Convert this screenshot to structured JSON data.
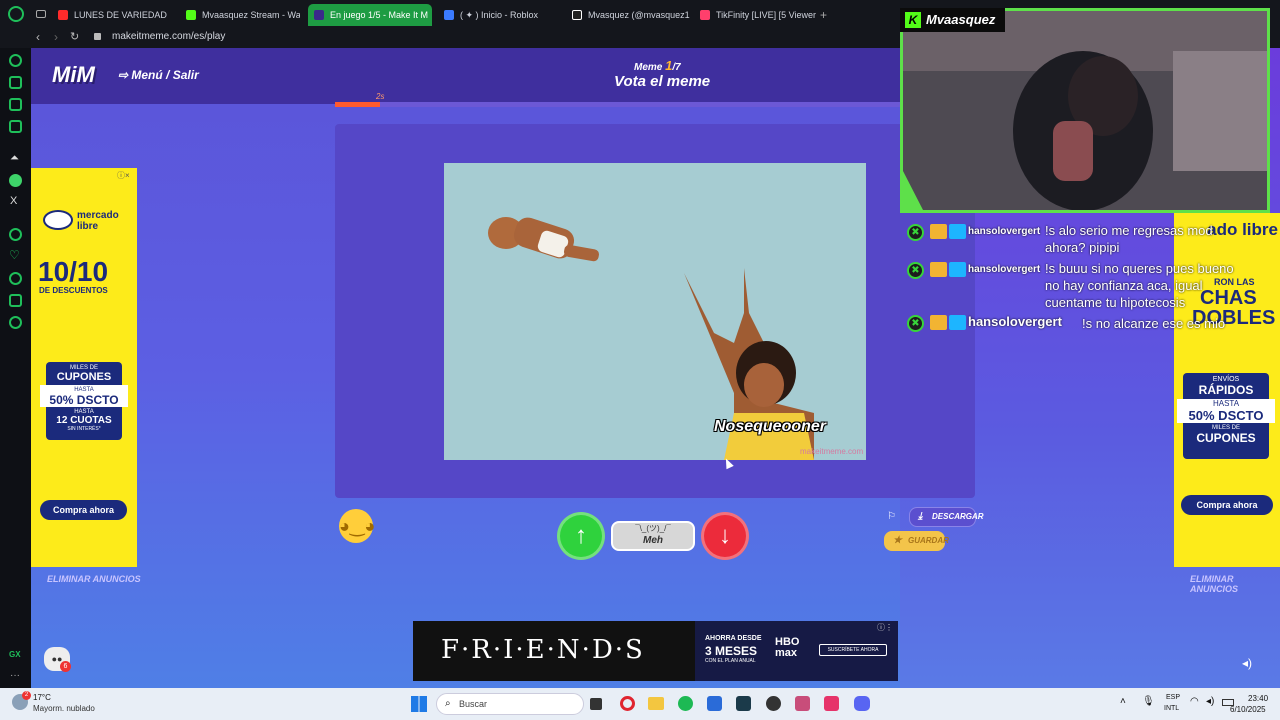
{
  "browser": {
    "tabs": [
      {
        "label": "LUNES DE VARIEDAD",
        "icon": "youtube-icon",
        "color": "#ff2b2b"
      },
      {
        "label": "Mvaasquez Stream - Wa",
        "icon": "kick-icon",
        "color": "#53fc18"
      },
      {
        "label": "En juego 1/5 - Make It M",
        "icon": "mim-icon",
        "color": "#ffffff",
        "active": true
      },
      {
        "label": "( ✦ ) Inicio - Roblox",
        "icon": "roblox-icon",
        "color": "#3b7bff"
      },
      {
        "label": "Mvasquez (@mvasquez1",
        "icon": "tiktok-icon",
        "color": "#ffffff"
      },
      {
        "label": "TikFinity [LIVE] [5 Viewer",
        "icon": "tikfinity-icon",
        "color": "#ff3f6c"
      }
    ],
    "url": "makeitmeme.com/es/play"
  },
  "game": {
    "logo": "MiM",
    "menu_label": "Menú / Salir",
    "meme_counter_prefix": "Meme",
    "meme_current": "1",
    "meme_total": "/7",
    "title": "Vota el meme",
    "timer": "2s",
    "progress": 0.08,
    "meme_caption": "Nosequeooner",
    "meme_watermark": "makeitmeme.com",
    "vote_meh_face": "¯\\_(ツ)_/¯",
    "vote_meh_label": "Meh",
    "download_label": "DESCARGAR",
    "save_label": "GUARDAR",
    "remove_ads_label": "ELIMINAR ANUNCIOS"
  },
  "left_ad": {
    "brand": "mercado libre",
    "headline": "10/10",
    "sub": "DE DESCUENTOS",
    "box1": "MILES DE",
    "box1b": "CUPONES",
    "box2": "HASTA",
    "box2b": "50% DSCTO",
    "box3": "HASTA",
    "box3b": "12 CUOTAS",
    "box3c": "SIN INTERÉS*",
    "cta": "Compra ahora"
  },
  "right_ad": {
    "brand": "ado libre",
    "line1": "RON LAS",
    "line2": "CHAS",
    "line3": "DOBLES",
    "box1": "ENVÍOS",
    "box1b": "RÁPIDOS",
    "box2": "HASTA",
    "box2b": "50% DSCTO",
    "box3": "MILES DE",
    "box3b": "CUPONES",
    "cta": "Compra ahora"
  },
  "bottom_ad": {
    "friends": "F·R·I·E·N·D·S",
    "promo1": "AHORRA DESDE",
    "promo2": "3 MESES",
    "promo3": "CON EL PLAN ANUAL",
    "brand": "HBO max",
    "cta": "SUSCRÍBETE AHORA"
  },
  "stream": {
    "streamer_name": "Mvaasquez",
    "chat": [
      {
        "user": "hansolovergert",
        "message": "!s alo serio me regresas mod ahora? pipipi"
      },
      {
        "user": "hansolovergert",
        "message": "!s buuu si no queres pues bueno no hay confianza aca, igual cuentame tu hipotecosis"
      },
      {
        "user": "hansolovergert",
        "message": "!s no alcanze ese es mio"
      }
    ]
  },
  "taskbar": {
    "weather_temp": "17°C",
    "weather_desc": "Mayorm. nublado",
    "search_placeholder": "Buscar",
    "lang1": "ESP",
    "lang2": "INTL",
    "time": "23:40",
    "date": "6/10/2025",
    "notification_count": "2"
  }
}
